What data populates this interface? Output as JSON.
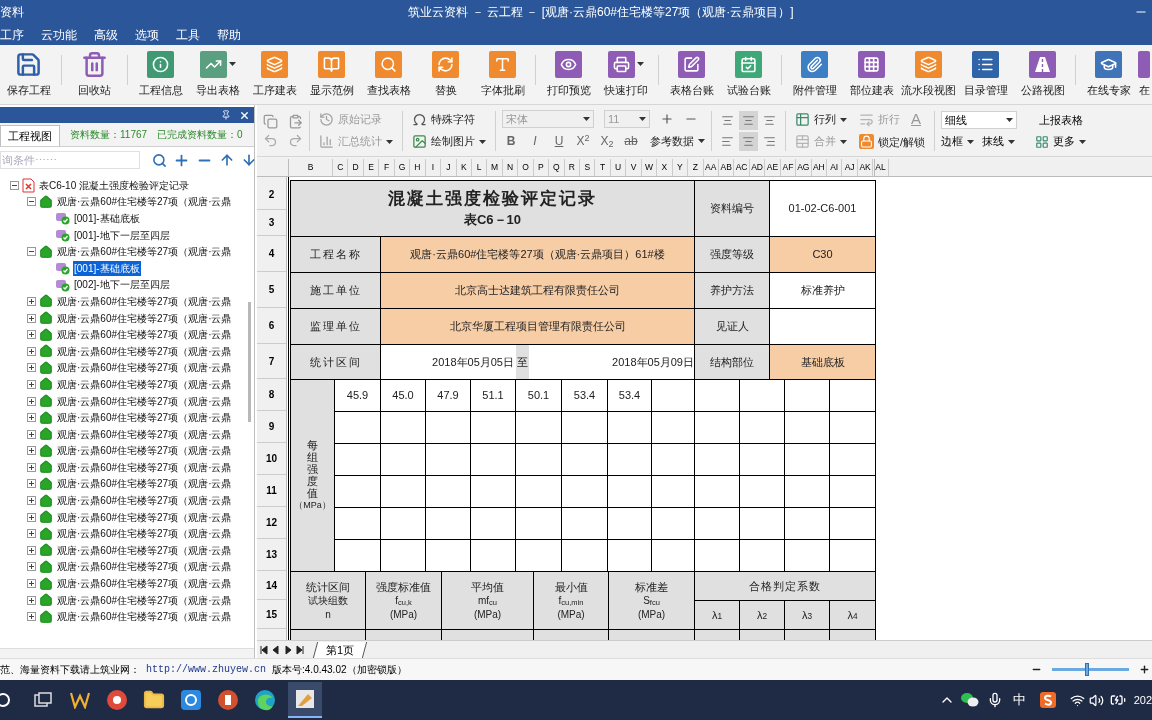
{
  "window": {
    "app_name": "资料",
    "title": "筑业云资料 － 云工程 － [观唐·云鼎60#住宅楼等27项（观唐·云鼎项目）]"
  },
  "menu": [
    "工序",
    "云功能",
    "高级",
    "选项",
    "工具",
    "帮助"
  ],
  "toolbar_groups": [
    [
      {
        "label": "保存工程",
        "dropdown": false
      }
    ],
    [
      {
        "label": "回收站",
        "dropdown": false
      }
    ],
    [
      {
        "label": "工程信息",
        "dropdown": false
      },
      {
        "label": "导出表格",
        "dropdown": true
      },
      {
        "label": "工序建表",
        "dropdown": false
      },
      {
        "label": "显示范例",
        "dropdown": false
      },
      {
        "label": "查找表格",
        "dropdown": false
      },
      {
        "label": "替换",
        "dropdown": false
      },
      {
        "label": "字体批刷",
        "dropdown": false
      }
    ],
    [
      {
        "label": "打印预览",
        "dropdown": false
      },
      {
        "label": "快速打印",
        "dropdown": true
      }
    ],
    [
      {
        "label": "表格台账",
        "dropdown": false
      },
      {
        "label": "试验台账",
        "dropdown": false
      }
    ],
    [
      {
        "label": "附件管理",
        "dropdown": false
      },
      {
        "label": "部位建表",
        "dropdown": false
      },
      {
        "label": "流水段视图",
        "dropdown": false
      },
      {
        "label": "目录管理",
        "dropdown": false
      },
      {
        "label": "公路视图",
        "dropdown": false
      }
    ],
    [
      {
        "label": "在线专家",
        "dropdown": false
      },
      {
        "label": "在",
        "dropdown": false
      }
    ]
  ],
  "panel": {
    "tabs": [
      {
        "label": "工程视图",
        "selected": true
      }
    ],
    "count": "资料数量：11767",
    "done_count": "已完成资料数量：0",
    "search": {
      "placeholder": "询条件⋯⋯"
    },
    "tree": [
      {
        "label": "表C6-10  混凝土强度检验评定记录",
        "expanded": true,
        "selected": false,
        "children": [
          {
            "label": "观唐·云鼎60#住宅楼等27项（观唐·云鼎",
            "expanded": true,
            "selected": false,
            "children": [
              {
                "label": "[001]-基础底板",
                "selected": false
              },
              {
                "label": "[001]-地下一层至四层",
                "selected": false
              }
            ]
          },
          {
            "label": "观唐·云鼎60#住宅楼等27项（观唐·云鼎",
            "expanded": true,
            "selected": false,
            "children": [
              {
                "label": "[001]-基础底板",
                "selected": true
              },
              {
                "label": "[002]-地下一层至四层",
                "selected": false
              }
            ]
          },
          {
            "label": "观唐·云鼎60#住宅楼等27项（观唐·云鼎",
            "expanded": false,
            "selected": false
          },
          {
            "label": "观唐·云鼎60#住宅楼等27项（观唐·云鼎",
            "expanded": false,
            "selected": false
          },
          {
            "label": "观唐·云鼎60#住宅楼等27项（观唐·云鼎",
            "expanded": false,
            "selected": false
          },
          {
            "label": "观唐·云鼎60#住宅楼等27项（观唐·云鼎",
            "expanded": false,
            "selected": false
          },
          {
            "label": "观唐·云鼎60#住宅楼等27项（观唐·云鼎",
            "expanded": false,
            "selected": false
          },
          {
            "label": "观唐·云鼎60#住宅楼等27项（观唐·云鼎",
            "expanded": false,
            "selected": false
          },
          {
            "label": "观唐·云鼎60#住宅楼等27项（观唐·云鼎",
            "expanded": false,
            "selected": false
          },
          {
            "label": "观唐·云鼎60#住宅楼等27项（观唐·云鼎",
            "expanded": false,
            "selected": false
          },
          {
            "label": "观唐·云鼎60#住宅楼等27项（观唐·云鼎",
            "expanded": false,
            "selected": false
          },
          {
            "label": "观唐·云鼎60#住宅楼等27项（观唐·云鼎",
            "expanded": false,
            "selected": false
          },
          {
            "label": "观唐·云鼎60#住宅楼等27项（观唐·云鼎",
            "expanded": false,
            "selected": false
          },
          {
            "label": "观唐·云鼎60#住宅楼等27项（观唐·云鼎",
            "expanded": false,
            "selected": false
          },
          {
            "label": "观唐·云鼎60#住宅楼等27项（观唐·云鼎",
            "expanded": false,
            "selected": false
          },
          {
            "label": "观唐·云鼎60#住宅楼等27项（观唐·云鼎",
            "expanded": false,
            "selected": false
          },
          {
            "label": "观唐·云鼎60#住宅楼等27项（观唐·云鼎",
            "expanded": false,
            "selected": false
          },
          {
            "label": "观唐·云鼎60#住宅楼等27项（观唐·云鼎",
            "expanded": false,
            "selected": false
          },
          {
            "label": "观唐·云鼎60#住宅楼等27项（观唐·云鼎",
            "expanded": false,
            "selected": false
          },
          {
            "label": "观唐·云鼎60#住宅楼等27项（观唐·云鼎",
            "expanded": false,
            "selected": false
          },
          {
            "label": "观唐·云鼎60#住宅楼等27项（观唐·云鼎",
            "expanded": false,
            "selected": false
          },
          {
            "label": "观唐·云鼎60#住宅楼等27项（观唐·云鼎",
            "expanded": false,
            "selected": false
          }
        ]
      }
    ]
  },
  "ribbon": {
    "original_record": {
      "label": "原始记录",
      "disabled": true
    },
    "summary": {
      "label": "汇总统计",
      "disabled": true
    },
    "special_chars": {
      "label": "特殊字符",
      "disabled": false
    },
    "draw_picture": {
      "label": "绘制图片",
      "disabled": false
    },
    "font": {
      "value": "宋体",
      "disabled": true
    },
    "font_size": {
      "value": "11",
      "disabled": true
    },
    "format_buttons": [
      "B",
      "I",
      "U",
      "X$^{2}$",
      "X$_{2}$",
      "ab"
    ],
    "reference_data": "参考数据",
    "align_buttons": [
      {
        "selected": false
      },
      {
        "selected": true
      },
      {
        "selected": false
      },
      {
        "selected": false
      },
      {
        "selected": true
      },
      {
        "selected": false
      }
    ],
    "rows_cols": {
      "label": "行列",
      "disabled": false
    },
    "merge": {
      "label": "合并",
      "disabled": true
    },
    "wrap": {
      "label": "折行",
      "disabled": true
    },
    "font_color": "A",
    "lock": "锁定/解锁",
    "line_style": "细线",
    "border": "边框",
    "erase_line": "抹线",
    "report": "上报表格",
    "more": "更多"
  },
  "sheet": {
    "columns": [
      "B",
      "C",
      "D",
      "E",
      "F",
      "G",
      "H",
      "I",
      "J",
      "K",
      "L",
      "M",
      "N",
      "O",
      "P",
      "Q",
      "R",
      "S",
      "T",
      "U",
      "V",
      "W",
      "X",
      "Y",
      "Z",
      "AA",
      "AB",
      "AC",
      "AD",
      "AE",
      "AF",
      "AG",
      "AH",
      "AI",
      "AJ",
      "AK",
      "AL"
    ],
    "row_numbers": [
      "2",
      "3",
      "4",
      "5",
      "6",
      "7",
      "8",
      "9",
      "10",
      "11",
      "12",
      "13",
      "14",
      "15"
    ],
    "title": "混凝土强度检验评定记录",
    "subtitle": "表C6－10",
    "record_no": {
      "label": "资料编号",
      "value": "01-02-C6-001"
    },
    "info_rows": [
      {
        "label": "工程名称",
        "value": "观唐·云鼎60#住宅楼等27项（观唐·云鼎项目）61#楼",
        "side_label": "强度等级",
        "side_value": "C30",
        "side_highlight": true
      },
      {
        "label": "施工单位",
        "value": "北京高士达建筑工程有限责任公司",
        "side_label": "养护方法",
        "side_value": "标准养护",
        "side_highlight": false
      },
      {
        "label": "监理单位",
        "value": "北京华厦工程项目管理有限责任公司",
        "side_label": "见证人",
        "side_highlight": false
      }
    ],
    "period": {
      "label": "统计区间",
      "from": "2018年05月05日",
      "to_word": "至",
      "to": "2018年05月09日",
      "side_label": "结构部位",
      "side_value": "基础底板",
      "side_highlight": true
    },
    "strength_label": "每组强度值",
    "strength_unit": "（MPa）",
    "strength_values": [
      "45.9",
      "45.0",
      "47.9",
      "51.1",
      "50.1",
      "53.4",
      "53.4"
    ],
    "stats_headers": [
      {
        "lines": [
          "统计区间",
          "试块组数",
          "n"
        ]
      },
      {
        "lines": [
          "强度标准值",
          "f$_{cu,k}$",
          "(MPa)"
        ]
      },
      {
        "lines": [
          "平均值",
          "mf$_{cu}$",
          "(MPa)"
        ]
      },
      {
        "lines": [
          "最小值",
          "f$_{cu,min}$",
          "(MPa)"
        ]
      },
      {
        "lines": [
          "标准差",
          "S$_{fcu}$",
          "(MPa)"
        ]
      }
    ],
    "coefficients": {
      "label": "合格判定系数",
      "items": [
        "λ$_{1}$",
        "λ$_{2}$",
        "λ$_{3}$",
        "λ$_{4}$"
      ]
    },
    "sheet_tabs": [
      {
        "label": "第1页",
        "selected": true
      }
    ]
  },
  "status_bar": {
    "notice": "范、海量资料下载请上筑业网：",
    "url": "http://www.zhuyew.cn",
    "version": "版本号:4.0.43.02（加密锁版）",
    "zoom": {
      "level": 0.45
    }
  },
  "taskbar": {
    "input_method": "中",
    "clock": "202"
  }
}
